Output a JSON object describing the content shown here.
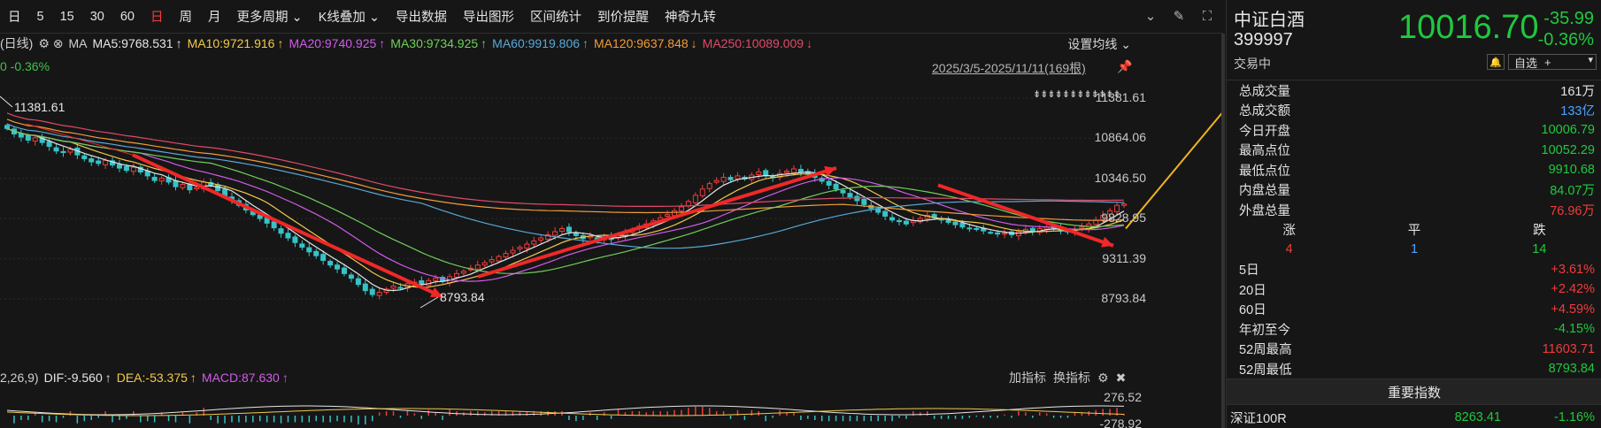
{
  "toolbar": {
    "periods": [
      "日",
      "5",
      "15",
      "30",
      "60",
      "日",
      "周",
      "月"
    ],
    "active_index": 5,
    "menus": [
      "更多周期 ⌄",
      "K线叠加 ⌄",
      "导出数据",
      "导出图形",
      "区间统计",
      "到价提醒",
      "神奇九转"
    ]
  },
  "ma_bar": {
    "prefix": "(日线)",
    "ma_label": "MA",
    "items": [
      {
        "text": "MA5:9768.531",
        "color": "#e6e6e6",
        "arrow": "↑"
      },
      {
        "text": "MA10:9721.916",
        "color": "#f2c94c",
        "arrow": "↑"
      },
      {
        "text": "MA20:9740.925",
        "color": "#d05ce8",
        "arrow": "↑"
      },
      {
        "text": "MA30:9734.925",
        "color": "#6fcf5a",
        "arrow": "↑"
      },
      {
        "text": "MA60:9919.806",
        "color": "#58a8d8",
        "arrow": "↑"
      },
      {
        "text": "MA120:9637.848",
        "color": "#f09b3c",
        "arrow": "↓"
      },
      {
        "text": "MA250:10089.009",
        "color": "#e04a6a",
        "arrow": "↓"
      }
    ],
    "settings": "设置均线 ⌄"
  },
  "pct_row": "0 -0.36%",
  "range_label": "2025/3/5-2025/11/11(169根)",
  "dots_label": "⇟⇟⇟⇟⇟⇟⇟⇟⇟⇟⇟⇟",
  "macd_bar": {
    "prefix": "2,26,9)",
    "items": [
      {
        "text": "DIF:-9.560",
        "color": "#e6e6e6",
        "arrow": "↑"
      },
      {
        "text": "DEA:-53.375",
        "color": "#f2c94c",
        "arrow": "↑"
      },
      {
        "text": "MACD:87.630",
        "color": "#d05ce8",
        "arrow": "↑"
      }
    ],
    "buttons": [
      "加指标",
      "换指标"
    ]
  },
  "chart_data": {
    "type": "candlestick",
    "y_ticks": [
      "11381.61",
      "10864.06",
      "10346.50",
      "9828.95",
      "9311.39",
      "8793.84"
    ],
    "y_range": [
      8793.84,
      11381.61
    ],
    "annotations": [
      {
        "text": "11381.61",
        "value": 11381.61
      },
      {
        "text": "8793.84",
        "value": 8793.84
      }
    ],
    "close_trend": [
      10990,
      10920,
      10880,
      10840,
      10870,
      10810,
      10760,
      10700,
      10680,
      10720,
      10650,
      10600,
      10560,
      10540,
      10580,
      10520,
      10480,
      10450,
      10490,
      10430,
      10380,
      10320,
      10350,
      10300,
      10240,
      10270,
      10200,
      10230,
      10300,
      10260,
      10190,
      10120,
      10060,
      10000,
      9940,
      9880,
      9830,
      9770,
      9710,
      9640,
      9580,
      9520,
      9460,
      9400,
      9350,
      9290,
      9230,
      9180,
      9120,
      9060,
      8980,
      8900,
      8850,
      8880,
      8920,
      8960,
      8940,
      8990,
      9010,
      8980,
      9030,
      9060,
      9020,
      9080,
      9120,
      9150,
      9190,
      9230,
      9260,
      9300,
      9340,
      9380,
      9420,
      9460,
      9500,
      9540,
      9580,
      9620,
      9660,
      9700,
      9660,
      9610,
      9570,
      9600,
      9560,
      9590,
      9560,
      9620,
      9650,
      9690,
      9730,
      9760,
      9800,
      9840,
      9880,
      9930,
      9980,
      10050,
      10130,
      10210,
      10280,
      10320,
      10360,
      10330,
      10380,
      10340,
      10390,
      10430,
      10380,
      10360,
      10410,
      10440,
      10470,
      10430,
      10400,
      10360,
      10310,
      10260,
      10210,
      10160,
      10110,
      10060,
      10010,
      9960,
      9910,
      9860,
      9810,
      9790,
      9760,
      9800,
      9830,
      9870,
      9840,
      9810,
      9780,
      9750,
      9720,
      9700,
      9690,
      9670,
      9650,
      9630,
      9640,
      9620,
      9660,
      9690,
      9670,
      9700,
      9720,
      9700,
      9680,
      9660,
      9690,
      9720,
      9760,
      9810,
      9870,
      9930,
      10000,
      10016.7
    ]
  },
  "panel": {
    "name": "中证白酒",
    "code": "399997",
    "price": "10016.70",
    "change": "-35.99",
    "change_pct": "-0.36%",
    "status": "交易中",
    "self_select": "自选",
    "stats": [
      {
        "label": "总成交量",
        "value": "161万",
        "color": "#e2e2e2"
      },
      {
        "label": "总成交额",
        "value": "133亿",
        "color": "#4aa3ff"
      },
      {
        "label": "今日开盘",
        "value": "10006.79",
        "color": "#1fc93e"
      },
      {
        "label": "最高点位",
        "value": "10052.29",
        "color": "#1fc93e"
      },
      {
        "label": "最低点位",
        "value": "9910.68",
        "color": "#1fc93e"
      },
      {
        "label": "内盘总量",
        "value": "84.07万",
        "color": "#1fc93e"
      },
      {
        "label": "外盘总量",
        "value": "76.96万",
        "color": "#f03c3c"
      }
    ],
    "breadth_labels": [
      "涨",
      "平",
      "跌"
    ],
    "breadth_values": [
      "4",
      "1",
      "14"
    ],
    "periods": [
      {
        "label": "5日",
        "value": "+3.61%",
        "color": "#f03c3c"
      },
      {
        "label": "20日",
        "value": "+2.42%",
        "color": "#f03c3c"
      },
      {
        "label": "60日",
        "value": "+4.59%",
        "color": "#f03c3c"
      },
      {
        "label": "年初至今",
        "value": "-4.15%",
        "color": "#1fc93e"
      },
      {
        "label": "52周最高",
        "value": "11603.71",
        "color": "#f03c3c"
      },
      {
        "label": "52周最低",
        "value": "8793.84",
        "color": "#1fc93e"
      }
    ],
    "important_title": "重要指数",
    "index_row": {
      "name": "深证100R",
      "price": "8263.41",
      "change": "-1.16%"
    }
  },
  "macd_ticks": [
    "276.52",
    "-278.92"
  ]
}
